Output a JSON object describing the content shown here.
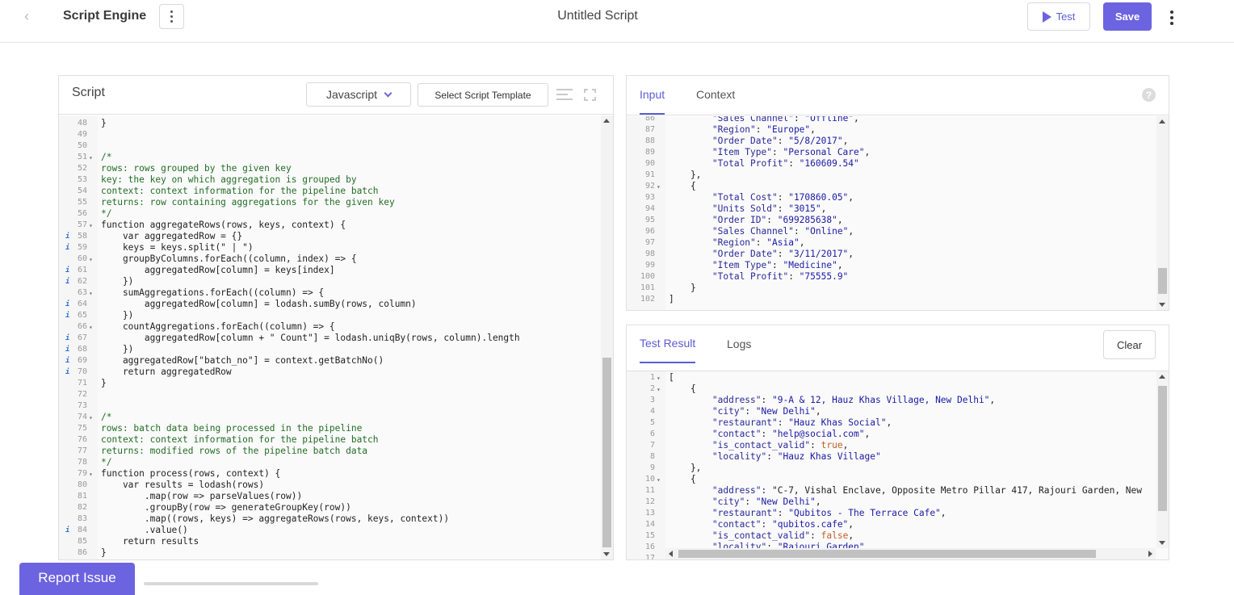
{
  "header": {
    "back_icon": "chevron-left-icon",
    "app_title": "Script Engine",
    "script_name": "Untitled Script",
    "test_label": "Test",
    "save_label": "Save",
    "accent_color": "#6c63e0"
  },
  "script_panel": {
    "title": "Script",
    "language": "Javascript",
    "template_label": "Select Script Template",
    "lines": [
      {
        "n": "48",
        "fold": "",
        "info": "",
        "text": "}"
      },
      {
        "n": "49",
        "fold": "",
        "info": "",
        "text": ""
      },
      {
        "n": "50",
        "fold": "",
        "info": "",
        "text": ""
      },
      {
        "n": "51",
        "fold": "▾",
        "info": "",
        "text": "/*",
        "cls": "c-comment"
      },
      {
        "n": "52",
        "fold": "",
        "info": "",
        "text": "rows: rows grouped by the given key",
        "cls": "c-comment"
      },
      {
        "n": "53",
        "fold": "",
        "info": "",
        "text": "key: the key on which aggregation is grouped by",
        "cls": "c-comment"
      },
      {
        "n": "54",
        "fold": "",
        "info": "",
        "text": "context: context information for the pipeline batch",
        "cls": "c-comment"
      },
      {
        "n": "55",
        "fold": "",
        "info": "",
        "text": "returns: row containing aggregations for the given key",
        "cls": "c-comment"
      },
      {
        "n": "56",
        "fold": "",
        "info": "",
        "text": "*/",
        "cls": "c-comment"
      },
      {
        "n": "57",
        "fold": "▾",
        "info": "",
        "text": "function aggregateRows(rows, keys, context) {"
      },
      {
        "n": "58",
        "fold": "",
        "info": "i",
        "text": "    var aggregatedRow = {}"
      },
      {
        "n": "59",
        "fold": "",
        "info": "i",
        "text": "    keys = keys.split(\" | \")"
      },
      {
        "n": "60",
        "fold": "▾",
        "info": "",
        "text": "    groupByColumns.forEach((column, index) => {"
      },
      {
        "n": "61",
        "fold": "",
        "info": "i",
        "text": "        aggregatedRow[column] = keys[index]"
      },
      {
        "n": "62",
        "fold": "",
        "info": "i",
        "text": "    })"
      },
      {
        "n": "63",
        "fold": "▾",
        "info": "",
        "text": "    sumAggregations.forEach((column) => {"
      },
      {
        "n": "64",
        "fold": "",
        "info": "i",
        "text": "        aggregatedRow[column] = lodash.sumBy(rows, column)"
      },
      {
        "n": "65",
        "fold": "",
        "info": "i",
        "text": "    })"
      },
      {
        "n": "66",
        "fold": "▾",
        "info": "",
        "text": "    countAggregations.forEach((column) => {"
      },
      {
        "n": "67",
        "fold": "",
        "info": "i",
        "text": "        aggregatedRow[column + \" Count\"] = lodash.uniqBy(rows, column).length"
      },
      {
        "n": "68",
        "fold": "",
        "info": "i",
        "text": "    })"
      },
      {
        "n": "69",
        "fold": "",
        "info": "i",
        "text": "    aggregatedRow[\"batch_no\"] = context.getBatchNo()"
      },
      {
        "n": "70",
        "fold": "",
        "info": "i",
        "text": "    return aggregatedRow"
      },
      {
        "n": "71",
        "fold": "",
        "info": "",
        "text": "}"
      },
      {
        "n": "72",
        "fold": "",
        "info": "",
        "text": ""
      },
      {
        "n": "73",
        "fold": "",
        "info": "",
        "text": ""
      },
      {
        "n": "74",
        "fold": "▾",
        "info": "",
        "text": "/*",
        "cls": "c-comment"
      },
      {
        "n": "75",
        "fold": "",
        "info": "",
        "text": "rows: batch data being processed in the pipeline",
        "cls": "c-comment"
      },
      {
        "n": "76",
        "fold": "",
        "info": "",
        "text": "context: context information for the pipeline batch",
        "cls": "c-comment"
      },
      {
        "n": "77",
        "fold": "",
        "info": "",
        "text": "returns: modified rows of the pipeline batch data",
        "cls": "c-comment"
      },
      {
        "n": "78",
        "fold": "",
        "info": "",
        "text": "*/",
        "cls": "c-comment"
      },
      {
        "n": "79",
        "fold": "▾",
        "info": "",
        "text": "function process(rows, context) {"
      },
      {
        "n": "80",
        "fold": "",
        "info": "",
        "text": "    var results = lodash(rows)"
      },
      {
        "n": "81",
        "fold": "",
        "info": "",
        "text": "        .map(row => parseValues(row))"
      },
      {
        "n": "82",
        "fold": "",
        "info": "",
        "text": "        .groupBy(row => generateGroupKey(row))"
      },
      {
        "n": "83",
        "fold": "",
        "info": "",
        "text": "        .map((rows, keys) => aggregateRows(rows, keys, context))"
      },
      {
        "n": "84",
        "fold": "",
        "info": "i",
        "text": "        .value()"
      },
      {
        "n": "85",
        "fold": "",
        "info": "",
        "text": "    return results"
      },
      {
        "n": "86",
        "fold": "",
        "info": "",
        "text": "}"
      }
    ],
    "scroll_position": 0.78
  },
  "input_panel": {
    "tabs": [
      "Input",
      "Context"
    ],
    "active_tab": "Input",
    "lines": [
      {
        "n": "86",
        "fold": "",
        "text": "        \"Sales Channel\": \"Offline\","
      },
      {
        "n": "87",
        "fold": "",
        "text": "        \"Region\": \"Europe\","
      },
      {
        "n": "88",
        "fold": "",
        "text": "        \"Order Date\": \"5/8/2017\","
      },
      {
        "n": "89",
        "fold": "",
        "text": "        \"Item Type\": \"Personal Care\","
      },
      {
        "n": "90",
        "fold": "",
        "text": "        \"Total Profit\": \"160609.54\""
      },
      {
        "n": "91",
        "fold": "",
        "text": "    },"
      },
      {
        "n": "92",
        "fold": "▾",
        "text": "    {"
      },
      {
        "n": "93",
        "fold": "",
        "text": "        \"Total Cost\": \"170860.05\","
      },
      {
        "n": "94",
        "fold": "",
        "text": "        \"Units Sold\": \"3015\","
      },
      {
        "n": "95",
        "fold": "",
        "text": "        \"Order ID\": \"699285638\","
      },
      {
        "n": "96",
        "fold": "",
        "text": "        \"Sales Channel\": \"Online\","
      },
      {
        "n": "97",
        "fold": "",
        "text": "        \"Region\": \"Asia\","
      },
      {
        "n": "98",
        "fold": "",
        "text": "        \"Order Date\": \"3/11/2017\","
      },
      {
        "n": "99",
        "fold": "",
        "text": "        \"Item Type\": \"Medicine\","
      },
      {
        "n": "100",
        "fold": "",
        "text": "        \"Total Profit\": \"75555.9\""
      },
      {
        "n": "101",
        "fold": "",
        "text": "    }"
      },
      {
        "n": "102",
        "fold": "",
        "text": "]"
      }
    ]
  },
  "result_panel": {
    "tabs": [
      "Test Result",
      "Logs"
    ],
    "active_tab": "Test Result",
    "clear_label": "Clear",
    "lines": [
      {
        "n": "1",
        "fold": "▾",
        "text": "["
      },
      {
        "n": "2",
        "fold": "▾",
        "text": "    {"
      },
      {
        "n": "3",
        "fold": "",
        "text": "        \"address\": \"9-A & 12, Hauz Khas Village, New Delhi\","
      },
      {
        "n": "4",
        "fold": "",
        "text": "        \"city\": \"New Delhi\","
      },
      {
        "n": "5",
        "fold": "",
        "text": "        \"restaurant\": \"Hauz Khas Social\","
      },
      {
        "n": "6",
        "fold": "",
        "text": "        \"contact\": \"help@social.com\","
      },
      {
        "n": "7",
        "fold": "",
        "text": "        \"is_contact_valid\": true,"
      },
      {
        "n": "8",
        "fold": "",
        "text": "        \"locality\": \"Hauz Khas Village\""
      },
      {
        "n": "9",
        "fold": "",
        "text": "    },"
      },
      {
        "n": "10",
        "fold": "▾",
        "text": "    {"
      },
      {
        "n": "11",
        "fold": "",
        "text": "        \"address\": \"C-7, Vishal Enclave, Opposite Metro Pillar 417, Rajouri Garden, New"
      },
      {
        "n": "12",
        "fold": "",
        "text": "        \"city\": \"New Delhi\","
      },
      {
        "n": "13",
        "fold": "",
        "text": "        \"restaurant\": \"Qubitos - The Terrace Cafe\","
      },
      {
        "n": "14",
        "fold": "",
        "text": "        \"contact\": \"qubitos.cafe\","
      },
      {
        "n": "15",
        "fold": "",
        "text": "        \"is_contact_valid\": false,"
      },
      {
        "n": "16",
        "fold": "",
        "text": "        \"locality\": \"Rajouri Garden\""
      },
      {
        "n": "17",
        "fold": "",
        "text": ""
      }
    ]
  },
  "footer": {
    "report_label": "Report Issue"
  }
}
